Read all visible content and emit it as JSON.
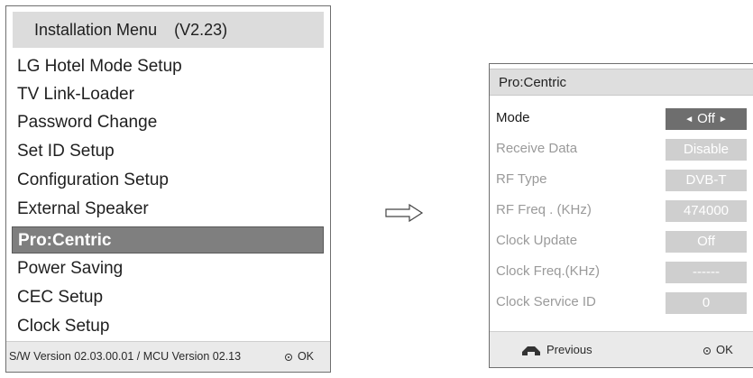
{
  "installation_menu": {
    "title": "Installation Menu",
    "version": "(V2.23)",
    "items": [
      {
        "label": "LG Hotel Mode Setup"
      },
      {
        "label": "TV Link-Loader"
      },
      {
        "label": "Password Change"
      },
      {
        "label": "Set ID Setup"
      },
      {
        "label": "Configuration Setup"
      },
      {
        "label": "External Speaker"
      },
      {
        "label": "Pro:Centric",
        "selected": true
      },
      {
        "label": "Power Saving"
      },
      {
        "label": "CEC Setup"
      },
      {
        "label": "Clock Setup"
      }
    ],
    "footer": {
      "version_text": "S/W Version 02.03.00.01 / MCU Version 02.13",
      "ok_label": "OK"
    }
  },
  "arrow": {
    "icon": "right-arrow-icon"
  },
  "procentric": {
    "title": "Pro:Centric",
    "rows": [
      {
        "label": "Mode",
        "value": "Off",
        "active": true
      },
      {
        "label": "Receive Data",
        "value": "Disable"
      },
      {
        "label": "RF Type",
        "value": "DVB-T"
      },
      {
        "label": "RF Freq . (KHz)",
        "value": "474000"
      },
      {
        "label": "Clock Update",
        "value": "Off"
      },
      {
        "label": "Clock Freq.(KHz)",
        "value": "------"
      },
      {
        "label": "Clock Service ID",
        "value": "0"
      }
    ],
    "footer": {
      "previous_label": "Previous",
      "ok_label": "OK"
    }
  },
  "colors": {
    "selected_bg": "#7f7f7f",
    "header_bg": "#dcdcdc",
    "value_bg": "#cfcfcf",
    "active_value_bg": "#6e6e6e"
  }
}
